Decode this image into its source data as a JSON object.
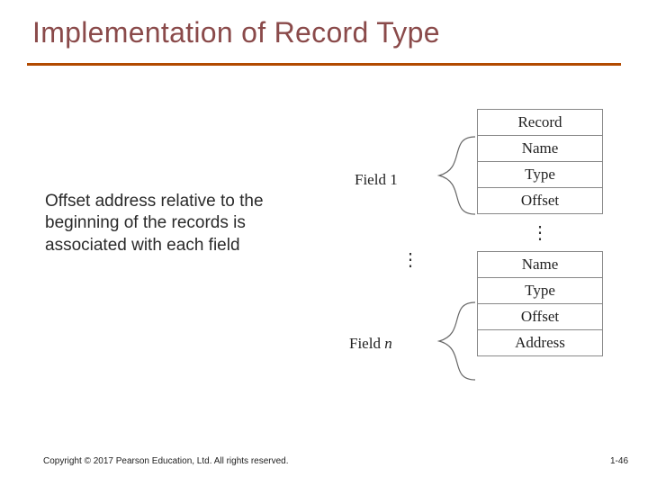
{
  "title": "Implementation of Record Type",
  "body_text": "Offset address relative to the beginning of the records is associated with each field",
  "diagram": {
    "cells": {
      "record": "Record",
      "name1": "Name",
      "type1": "Type",
      "offset1": "Offset",
      "name_n": "Name",
      "type_n": "Type",
      "offset_n": "Offset",
      "address": "Address"
    },
    "labels": {
      "field1": "Field 1",
      "fieldn_prefix": "Field ",
      "fieldn_var": "n"
    }
  },
  "footer": {
    "copyright": "Copyright © 2017 Pearson Education, Ltd. All rights reserved.",
    "page_number": "1-46"
  }
}
